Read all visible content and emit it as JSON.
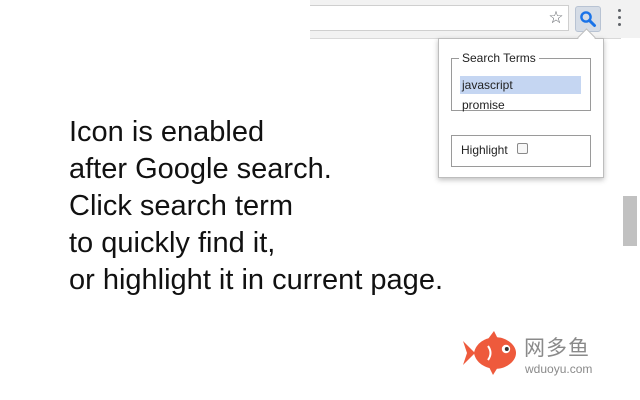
{
  "toolbar": {
    "star_icon": "star-outline-icon",
    "extension_icon": "magnifier-icon",
    "menu_icon": "vertical-dots-icon"
  },
  "popup": {
    "search_terms_legend": "Search Terms",
    "terms": [
      {
        "label": "javascript",
        "selected": true
      },
      {
        "label": "promise",
        "selected": false
      }
    ],
    "highlight_label": "Highlight",
    "highlight_checked": false
  },
  "description": {
    "lines": [
      "Icon is enabled",
      "after Google search.",
      "Click search term",
      "to quickly find it,",
      "or highlight it in current page."
    ]
  },
  "watermark": {
    "brand": "网多鱼",
    "domain": "wduoyu.com"
  },
  "colors": {
    "selection": "#c5d6f2",
    "extension_icon": "#1a73e8",
    "watermark_fish": "#ee5a3c"
  }
}
